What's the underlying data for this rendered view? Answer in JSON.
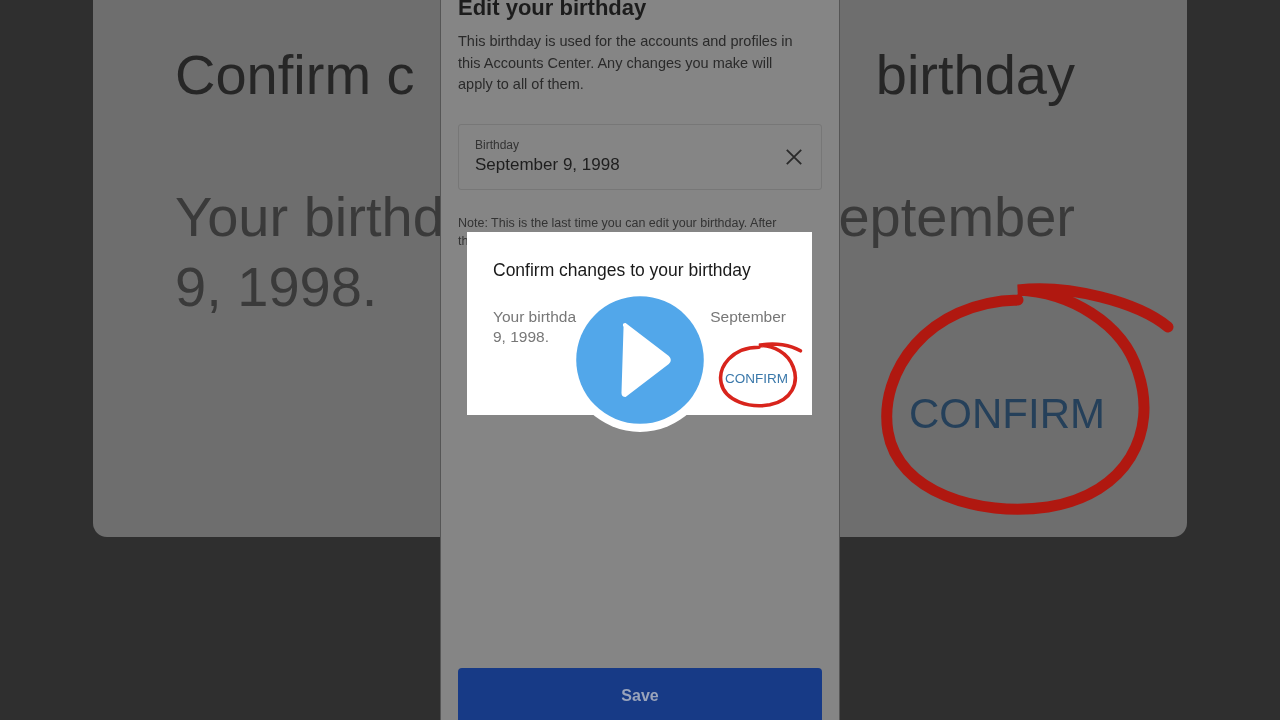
{
  "background_card": {
    "title_left": "Confirm c",
    "title_right": "birthday",
    "body_left": "Your birthd",
    "body_right": "eptember",
    "body_line2": "9, 1998.",
    "confirm": "CONFIRM"
  },
  "phone": {
    "heading": "Edit your birthday",
    "description": "This birthday is used for the accounts and profiles in this Accounts Center. Any changes you make will apply to all of them.",
    "field": {
      "label": "Birthday",
      "value": "September 9, 1998"
    },
    "note": [
      "Note: This is the last time you can edit your birthday. After",
      "th"
    ],
    "save_button": "Save"
  },
  "dialog": {
    "title": "Confirm changes to your birthday",
    "body_left": "Your birthda",
    "body_right": "September",
    "body_line2": "9, 1998.",
    "confirm_button": "CONFIRM"
  }
}
